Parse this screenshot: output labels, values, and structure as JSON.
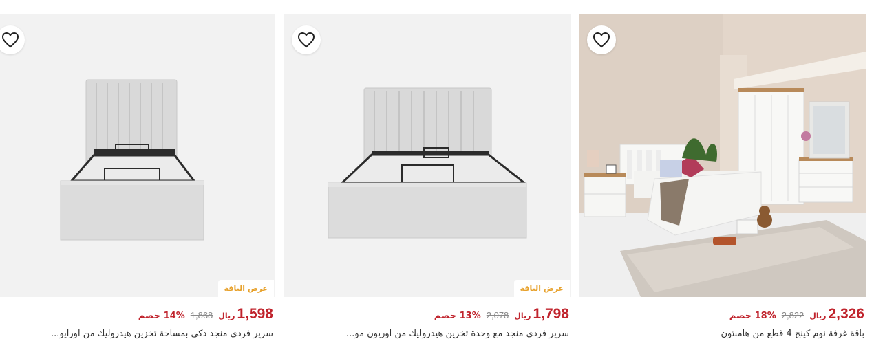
{
  "products": [
    {
      "title": "باقة غرفة نوم كينج 4 قطع من هامبتون",
      "price": "2,326",
      "currency": "ريال",
      "old_price": "2,822",
      "discount": "18% خصم",
      "offer_badge": "",
      "image": "bedroom-set-photo",
      "wishlist_icon": "heart-outline-icon"
    },
    {
      "title": "سرير فردي منجد مع وحدة تخزين هيدروليك من أوريون مو...",
      "price": "1,798",
      "currency": "ريال",
      "old_price": "2,078",
      "discount": "13% خصم",
      "offer_badge": "عرض الباقة",
      "image": "storage-bed-photo",
      "wishlist_icon": "heart-outline-icon"
    },
    {
      "title": "سرير فردي منجد ذكي بمساحة تخزين هيدروليك من أورايو...",
      "price": "1,598",
      "currency": "ريال",
      "old_price": "1,868",
      "discount": "14% خصم",
      "offer_badge": "عرض الباقة",
      "image": "storage-bed-photo",
      "wishlist_icon": "heart-outline-icon"
    }
  ],
  "colors": {
    "price": "#c0232c",
    "offer": "#e7a12c",
    "image_bg": "#f2f2f2"
  }
}
